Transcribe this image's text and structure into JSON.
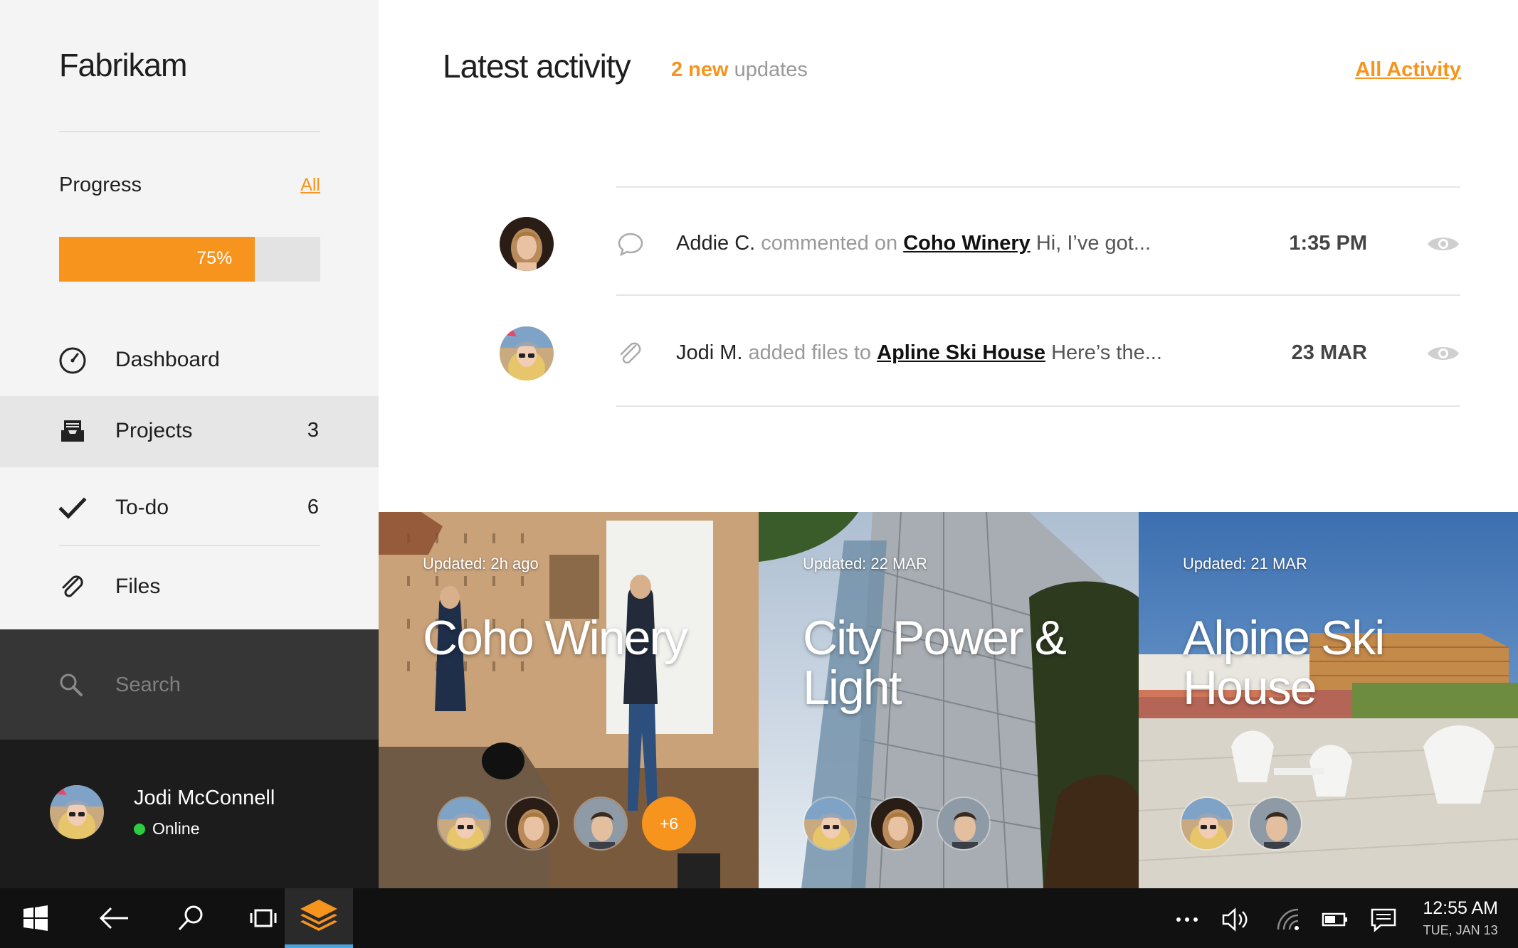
{
  "sidebar": {
    "brand": "Fabrikam",
    "progress": {
      "title": "Progress",
      "all_link": "All",
      "percent": 75,
      "label": "75%"
    },
    "nav": [
      {
        "label": "Dashboard",
        "icon": "dashboard-gauge-icon",
        "count": ""
      },
      {
        "label": "Projects",
        "icon": "projects-tray-icon",
        "count": "3"
      },
      {
        "label": "To-do",
        "icon": "checkmark-icon",
        "count": "6"
      },
      {
        "label": "Files",
        "icon": "paperclip-icon",
        "count": ""
      }
    ],
    "search": {
      "placeholder": "Search"
    },
    "user": {
      "name": "Jodi McConnell",
      "status": "Online"
    }
  },
  "main": {
    "title": "Latest activity",
    "new_count": "2 new",
    "new_suffix": "updates",
    "all_activity": "All Activity",
    "activity": [
      {
        "who": "Addie C.",
        "action": "commented on",
        "project": "Coho Winery",
        "snippet": "Hi, I’ve got...",
        "time": "1:35 PM",
        "type_icon": "comment-bubble-icon"
      },
      {
        "who": "Jodi M.",
        "action": "added files to",
        "project": "Apline Ski House",
        "snippet": "Here’s the...",
        "time": "23 MAR",
        "type_icon": "paperclip-icon"
      }
    ]
  },
  "projects": [
    {
      "updated": "Updated: 2h ago",
      "title": "Coho Winery",
      "more": "+6"
    },
    {
      "updated": "Updated: 22 MAR",
      "title": "City Power & Light",
      "more": ""
    },
    {
      "updated": "Updated: 21 MAR",
      "title": "Alpine Ski House",
      "more": ""
    }
  ],
  "taskbar": {
    "time": "12:55 AM",
    "date": "TUE, JAN 13"
  },
  "colors": {
    "accent": "#f7941d",
    "online": "#2ecc40",
    "taskbar_highlight": "#4aa3df"
  }
}
